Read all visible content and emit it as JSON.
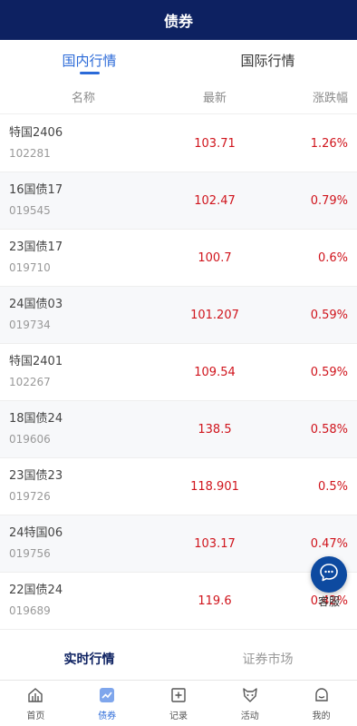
{
  "header": {
    "title": "债券"
  },
  "tabs": [
    {
      "label": "国内行情",
      "active": true
    },
    {
      "label": "国际行情",
      "active": false
    }
  ],
  "columns": {
    "name": "名称",
    "latest": "最新",
    "change": "涨跌幅"
  },
  "rows": [
    {
      "name": "特国2406",
      "code": "102281",
      "price": "103.71",
      "change": "1.26%"
    },
    {
      "name": "16国债17",
      "code": "019545",
      "price": "102.47",
      "change": "0.79%"
    },
    {
      "name": "23国债17",
      "code": "019710",
      "price": "100.7",
      "change": "0.6%"
    },
    {
      "name": "24国债03",
      "code": "019734",
      "price": "101.207",
      "change": "0.59%"
    },
    {
      "name": "特国2401",
      "code": "102267",
      "price": "109.54",
      "change": "0.59%"
    },
    {
      "name": "18国债24",
      "code": "019606",
      "price": "138.5",
      "change": "0.58%"
    },
    {
      "name": "23国债23",
      "code": "019726",
      "price": "118.901",
      "change": "0.5%"
    },
    {
      "name": "24特国06",
      "code": "019756",
      "price": "103.17",
      "change": "0.47%"
    },
    {
      "name": "22国债24",
      "code": "019689",
      "price": "119.6",
      "change": "0.42%"
    }
  ],
  "subnav": [
    {
      "label": "实时行情",
      "active": true
    },
    {
      "label": "证券市场",
      "active": false
    }
  ],
  "tabbar": [
    {
      "label": "首页",
      "icon": "home-icon",
      "active": false
    },
    {
      "label": "债券",
      "icon": "bond-chart-icon",
      "active": true
    },
    {
      "label": "记录",
      "icon": "record-plus-icon",
      "active": false
    },
    {
      "label": "活动",
      "icon": "activity-fox-icon",
      "active": false
    },
    {
      "label": "我的",
      "icon": "profile-smile-icon",
      "active": false
    }
  ],
  "customer_service": {
    "label": "客服",
    "icon": "chat-bubble-icon"
  },
  "colors": {
    "header_bg": "#0d2161",
    "accent": "#2b6ad8",
    "up_red": "#d0141c"
  }
}
